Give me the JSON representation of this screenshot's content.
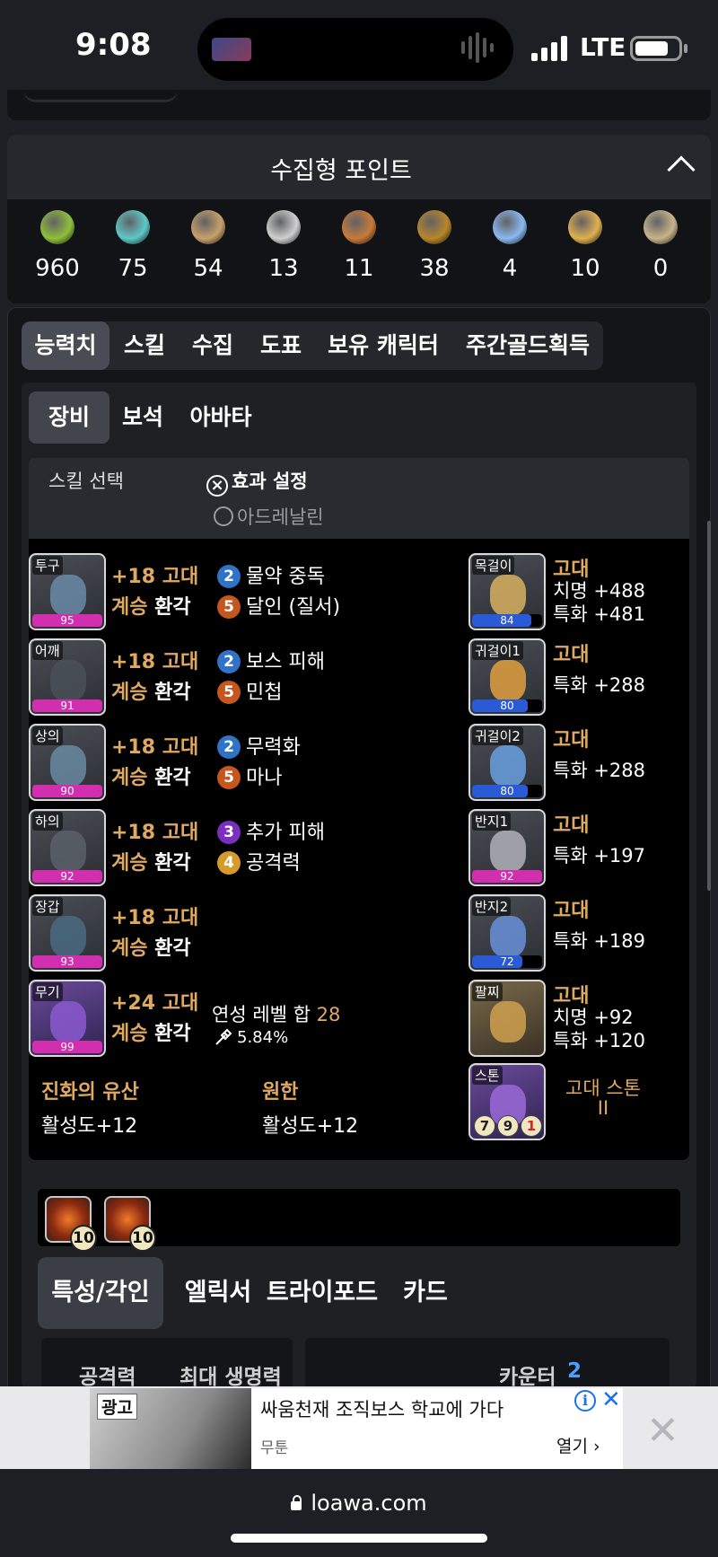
{
  "status": {
    "time": "9:08",
    "network": "LTE"
  },
  "collect": {
    "title": "수집형 포인트",
    "items": [
      {
        "value": "960",
        "color": "#8fbf3a"
      },
      {
        "value": "75",
        "color": "#5ec8c8"
      },
      {
        "value": "54",
        "color": "#c8a06a"
      },
      {
        "value": "13",
        "color": "#cfcfcf"
      },
      {
        "value": "11",
        "color": "#c87a3a"
      },
      {
        "value": "38",
        "color": "#b8862a"
      },
      {
        "value": "4",
        "color": "#8ab8f0"
      },
      {
        "value": "10",
        "color": "#e0b050"
      },
      {
        "value": "0",
        "color": "#c8b48a"
      }
    ]
  },
  "tabs_main": [
    "능력치",
    "스킬",
    "수집",
    "도표",
    "보유 캐릭터",
    "주간골드획득"
  ],
  "tabs_equip": [
    "장비",
    "보석",
    "아바타"
  ],
  "skill": {
    "label": "스킬 선택",
    "opt1": "효과 설정",
    "opt2": "아드레날린"
  },
  "gear": [
    {
      "slot": "투구",
      "level": "95",
      "tier": "+18 고대",
      "succ": "계승",
      "name": "환각",
      "effects": [
        {
          "n": "2",
          "c": "b-blue",
          "t": "물약 중독"
        },
        {
          "n": "5",
          "c": "b-orange",
          "t": "달인 (질서)"
        }
      ]
    },
    {
      "slot": "어깨",
      "level": "91",
      "tier": "+18 고대",
      "succ": "계승",
      "name": "환각",
      "effects": [
        {
          "n": "2",
          "c": "b-blue",
          "t": "보스 피해"
        },
        {
          "n": "5",
          "c": "b-orange",
          "t": "민첩"
        }
      ]
    },
    {
      "slot": "상의",
      "level": "90",
      "tier": "+18 고대",
      "succ": "계승",
      "name": "환각",
      "effects": [
        {
          "n": "2",
          "c": "b-blue",
          "t": "무력화"
        },
        {
          "n": "5",
          "c": "b-orange",
          "t": "마나"
        }
      ]
    },
    {
      "slot": "하의",
      "level": "92",
      "tier": "+18 고대",
      "succ": "계승",
      "name": "환각",
      "effects": [
        {
          "n": "3",
          "c": "b-purple",
          "t": "추가 피해"
        },
        {
          "n": "4",
          "c": "b-gold",
          "t": "공격력"
        }
      ]
    },
    {
      "slot": "장갑",
      "level": "93",
      "tier": "+18 고대",
      "succ": "계승",
      "name": "환각",
      "effects": []
    },
    {
      "slot": "무기",
      "level": "99",
      "tier": "+24 고대",
      "succ": "계승",
      "name": "환각",
      "effects": []
    }
  ],
  "refine": {
    "label": "연성 레벨 합",
    "value": "28",
    "percent": "5.84%"
  },
  "acc": [
    {
      "slot": "목걸이",
      "level": "84",
      "tier": "고대",
      "lines": [
        "치명 +488",
        "특화 +481"
      ]
    },
    {
      "slot": "귀걸이1",
      "level": "80",
      "tier": "고대",
      "lines": [
        "특화 +288"
      ]
    },
    {
      "slot": "귀걸이2",
      "level": "80",
      "tier": "고대",
      "lines": [
        "특화 +288"
      ]
    },
    {
      "slot": "반지1",
      "level": "92",
      "tier": "고대",
      "lines": [
        "특화 +197"
      ]
    },
    {
      "slot": "반지2",
      "level": "72",
      "tier": "고대",
      "lines": [
        "특화 +189"
      ]
    },
    {
      "slot": "팔찌",
      "level": "",
      "tier": "고대",
      "lines": [
        "치명 +92",
        "특화 +120"
      ]
    }
  ],
  "stone": {
    "slot": "스톤",
    "tier": "고대 스톤",
    "grade": "II",
    "nums": [
      "7",
      "9",
      "1"
    ]
  },
  "legacy": [
    {
      "title": "진화의 유산",
      "value": "활성도+12"
    },
    {
      "title": "원한",
      "value": "활성도+12"
    }
  ],
  "gems": [
    {
      "level": "10"
    },
    {
      "level": "10"
    }
  ],
  "tabs_bottom": [
    "특성/각인",
    "엘릭서",
    "트라이포드",
    "카드"
  ],
  "stats_peek": {
    "atk": "공격력",
    "hp": "최대 생명력",
    "counter": "카운터",
    "counter_val": "2"
  },
  "ad": {
    "tag": "광고",
    "headline": "싸움천재 조직보스 학교에 가다",
    "source": "무툰",
    "open": "열기"
  },
  "url": "loawa.com"
}
